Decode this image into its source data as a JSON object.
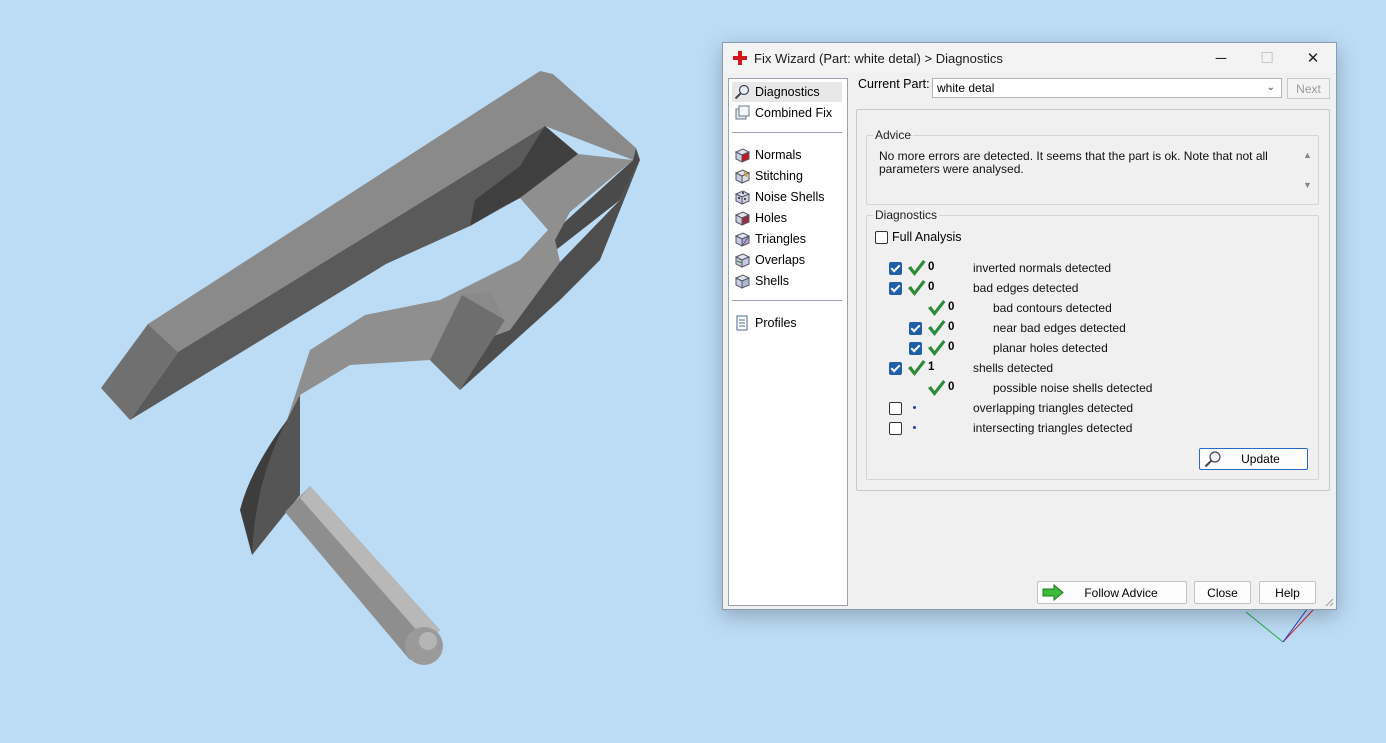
{
  "window": {
    "title": "Fix Wizard (Part: white detal) > Diagnostics",
    "minimize_glyph": "─",
    "maximize_glyph": "☐",
    "close_glyph": "✕"
  },
  "nav": {
    "items": [
      {
        "label": "Diagnostics",
        "icon": "magnifier-icon",
        "selected": true
      },
      {
        "label": "Combined Fix",
        "icon": "combined-fix-icon"
      },
      {
        "label": "Normals",
        "icon": "normals-cube-icon"
      },
      {
        "label": "Stitching",
        "icon": "stitching-icon"
      },
      {
        "label": "Noise Shells",
        "icon": "noise-shells-icon"
      },
      {
        "label": "Holes",
        "icon": "holes-cube-icon"
      },
      {
        "label": "Triangles",
        "icon": "triangles-cube-icon"
      },
      {
        "label": "Overlaps",
        "icon": "overlaps-cube-icon"
      },
      {
        "label": "Shells",
        "icon": "shells-cube-icon"
      },
      {
        "label": "Profiles",
        "icon": "profiles-document-icon"
      }
    ]
  },
  "header": {
    "current_part_label": "Current Part:",
    "current_part_value": "white detal",
    "next_label": "Next"
  },
  "advice": {
    "title": "Advice",
    "text": "No more errors are detected. It seems that the part is ok. Note that not all parameters were analysed."
  },
  "diagnostics": {
    "title": "Diagnostics",
    "full_analysis_label": "Full Analysis",
    "full_analysis_checked": false,
    "rows": [
      {
        "count": "0",
        "label": "inverted normals detected",
        "checked": true,
        "status": "ok"
      },
      {
        "count": "0",
        "label": "bad edges detected",
        "checked": true,
        "status": "ok"
      },
      {
        "count": "0",
        "label": "bad contours detected",
        "checked": null,
        "status": "ok"
      },
      {
        "count": "0",
        "label": "near bad edges detected",
        "checked": true,
        "status": "ok"
      },
      {
        "count": "0",
        "label": "planar holes detected",
        "checked": true,
        "status": "ok"
      },
      {
        "count": "1",
        "label": "shells detected",
        "checked": true,
        "status": "ok"
      },
      {
        "count": "0",
        "label": "possible noise shells detected",
        "checked": null,
        "status": "ok"
      },
      {
        "count": "",
        "label": "overlapping triangles detected",
        "checked": false,
        "status": "not-run"
      },
      {
        "count": "",
        "label": "intersecting triangles detected",
        "checked": false,
        "status": "not-run"
      }
    ],
    "update_label": "Update"
  },
  "footer": {
    "follow_advice_label": "Follow Advice",
    "close_label": "Close",
    "help_label": "Help"
  },
  "colors": {
    "viewport_background": "#bcdcf6",
    "model_gray": "#6f6f6f",
    "check_green": "#2e8b3a",
    "checkbox_blue": "#1f5fa8",
    "app_icon_red": "#d4161c"
  }
}
